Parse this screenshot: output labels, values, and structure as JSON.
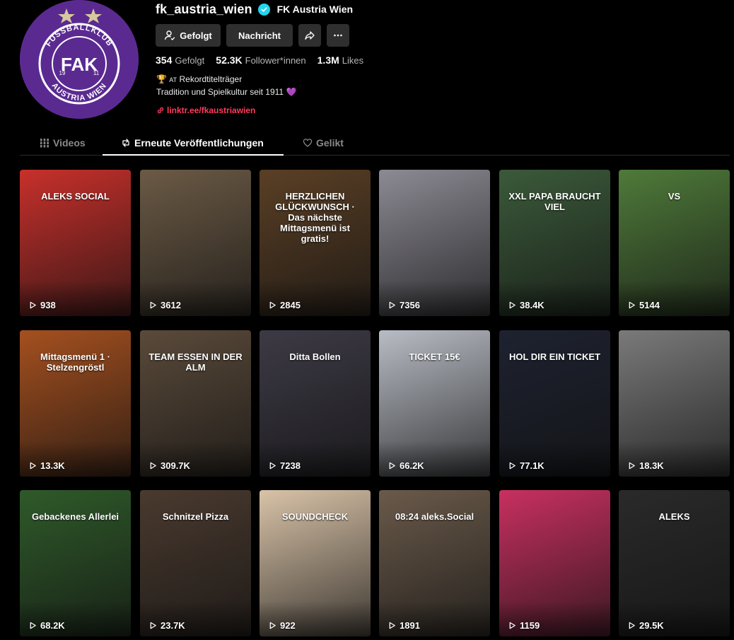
{
  "profile": {
    "username": "fk_austria_wien",
    "nickname": "FK Austria Wien",
    "avatar_text": {
      "top": "FUSSBALLKLUB",
      "bottom": "AUSTRIA WIEN",
      "monogram": "FAK",
      "year_left": "19",
      "year_right": "11"
    },
    "buttons": {
      "follow": "Gefolgt",
      "message": "Nachricht"
    },
    "stats": [
      {
        "value": "354",
        "label": "Gefolgt"
      },
      {
        "value": "52.3K",
        "label": "Follower*innen"
      },
      {
        "value": "1.3M",
        "label": "Likes"
      }
    ],
    "bio_line1_emoji": "🏆",
    "bio_line1_flag": "AT",
    "bio_line1_text": "Rekordtitelträger",
    "bio_line2_text": "Tradition und Spielkultur seit 1911",
    "bio_line2_emoji": "💜",
    "link": "linktr.ee/fkaustriawien"
  },
  "tabs": [
    {
      "label": "Videos",
      "icon": "grid-icon",
      "active": false
    },
    {
      "label": "Erneute Veröffentlichungen",
      "icon": "repost-icon",
      "active": true
    },
    {
      "label": "Gelikt",
      "icon": "heart-icon",
      "active": false
    }
  ],
  "colors": {
    "accent": "#ff3b5c",
    "verified": "#20d5ec",
    "brand_purple": "#5b2a91"
  },
  "videos": [
    {
      "views": "938",
      "caption": "ALEKS SOCIAL",
      "bg": "#c8302b"
    },
    {
      "views": "3612",
      "caption": "",
      "bg": "#6b5a45"
    },
    {
      "views": "2845",
      "caption": "HERZLICHEN GLÜCKWUNSCH · Das nächste Mittagsmenü ist gratis!",
      "bg": "#5a3f25"
    },
    {
      "views": "7356",
      "caption": "",
      "bg": "#8c8a93"
    },
    {
      "views": "38.4K",
      "caption": "XXL PAPA BRAUCHT VIEL",
      "bg": "#3b5a3a"
    },
    {
      "views": "5144",
      "caption": "VS",
      "bg": "#4f7a3a"
    },
    {
      "views": "13.3K",
      "caption": "Mittagsmenü 1 · Stelzengröstl",
      "bg": "#a5501f"
    },
    {
      "views": "309.7K",
      "caption": "TEAM ESSEN IN DER ALM",
      "bg": "#5a4a3a"
    },
    {
      "views": "7238",
      "caption": "Ditta Bollen",
      "bg": "#3d3a45"
    },
    {
      "views": "66.2K",
      "caption": "TICKET 15€",
      "bg": "#b8bcc4"
    },
    {
      "views": "77.1K",
      "caption": "HOL DIR EIN TICKET",
      "bg": "#1e2230"
    },
    {
      "views": "18.3K",
      "caption": "",
      "bg": "#7a7a7a"
    },
    {
      "views": "68.2K",
      "caption": "Gebackenes Allerlei",
      "bg": "#2f5a2a"
    },
    {
      "views": "23.7K",
      "caption": "Schnitzel Pizza",
      "bg": "#4a3a2f"
    },
    {
      "views": "922",
      "caption": "SOUNDCHECK",
      "bg": "#d9c3a8"
    },
    {
      "views": "1891",
      "caption": "08:24 aleks.Social",
      "bg": "#6a5a4a"
    },
    {
      "views": "1159",
      "caption": "",
      "bg": "#c83060"
    },
    {
      "views": "29.5K",
      "caption": "ALEKS",
      "bg": "#2a2a2a"
    }
  ]
}
